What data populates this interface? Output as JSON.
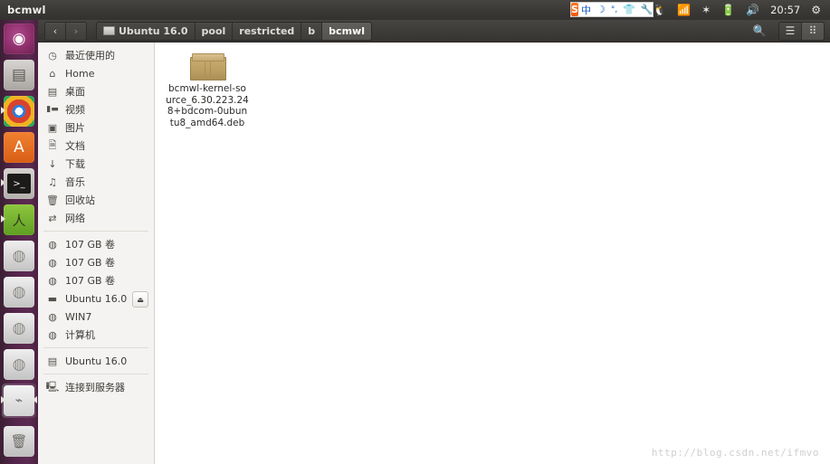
{
  "window": {
    "title": "bcmwl"
  },
  "top_panel": {
    "ime": {
      "logo": "S",
      "items": [
        {
          "name": "ime-mode-chinese",
          "glyph": "中"
        },
        {
          "name": "ime-moon-icon",
          "glyph": "☽"
        },
        {
          "name": "ime-punctuation-icon",
          "glyph": "°,"
        },
        {
          "name": "ime-skin-icon",
          "glyph": "👕"
        },
        {
          "name": "ime-toolbox-icon",
          "glyph": "🔧"
        }
      ]
    },
    "tray": [
      {
        "name": "linux-penguin-icon",
        "glyph": "🐧"
      },
      {
        "name": "wifi-icon",
        "glyph": "📶"
      },
      {
        "name": "bluetooth-icon",
        "glyph": "✶"
      },
      {
        "name": "battery-icon",
        "glyph": "🔋"
      },
      {
        "name": "volume-icon",
        "glyph": "🔊"
      }
    ],
    "clock": "20:57",
    "settings_icon": "⚙"
  },
  "launcher": {
    "items": [
      {
        "name": "launcher-ubuntu-dash",
        "label": "Ubuntu Dash",
        "style": "li-dash",
        "glyph": "◉",
        "active": false,
        "selected": false
      },
      {
        "name": "launcher-files",
        "label": "Files",
        "style": "li-files",
        "glyph": "▤",
        "active": false,
        "selected": false
      },
      {
        "name": "launcher-chrome",
        "label": "Google Chrome",
        "style": "li-chrome",
        "glyph": "",
        "active": true,
        "selected": false
      },
      {
        "name": "launcher-ubuntu-software",
        "label": "Ubuntu Software",
        "style": "li-soft",
        "glyph": "A",
        "active": false,
        "selected": false
      },
      {
        "name": "launcher-terminal",
        "label": "Terminal",
        "style": "li-term",
        "glyph": ">_",
        "active": true,
        "selected": false
      },
      {
        "name": "launcher-android-studio",
        "label": "Android Studio",
        "style": "li-as",
        "glyph": "A",
        "active": true,
        "selected": false
      },
      {
        "name": "launcher-drive-1",
        "label": "107 GB Volume",
        "style": "li-drive",
        "glyph": "◍",
        "active": false,
        "selected": false
      },
      {
        "name": "launcher-drive-2",
        "label": "107 GB Volume",
        "style": "li-drive",
        "glyph": "◍",
        "active": false,
        "selected": false
      },
      {
        "name": "launcher-drive-3",
        "label": "107 GB Volume",
        "style": "li-drive",
        "glyph": "◍",
        "active": false,
        "selected": false
      },
      {
        "name": "launcher-drive-4",
        "label": "WIN7",
        "style": "li-drive",
        "glyph": "◍",
        "active": false,
        "selected": false
      },
      {
        "name": "launcher-usb-drive",
        "label": "Ubuntu 16.0",
        "style": "li-usb",
        "glyph": "⌁",
        "active": true,
        "selected": true
      }
    ],
    "trash": {
      "name": "launcher-trash",
      "label": "Trash",
      "style": "li-trash",
      "glyph": "🗑"
    }
  },
  "toolbar": {
    "back_glyph": "‹",
    "forward_glyph": "›",
    "breadcrumbs": [
      {
        "label": "Ubuntu 16.0",
        "icon": "drive-icon",
        "active": false
      },
      {
        "label": "pool",
        "icon": "",
        "active": false
      },
      {
        "label": "restricted",
        "icon": "",
        "active": false
      },
      {
        "label": "b",
        "icon": "",
        "active": false
      },
      {
        "label": "bcmwl",
        "icon": "",
        "active": true
      }
    ],
    "search_icon": "🔍",
    "list_view_icon": "☰",
    "grid_view_icon": "⠿"
  },
  "sidebar": {
    "groups": [
      {
        "items": [
          {
            "label": "最近使用的",
            "icon": "clock-icon",
            "glyph": "◷",
            "eject": false
          },
          {
            "label": "Home",
            "icon": "home-icon",
            "glyph": "⌂",
            "eject": false
          },
          {
            "label": "桌面",
            "icon": "desktop-folder-icon",
            "glyph": "▤",
            "eject": false
          },
          {
            "label": "视频",
            "icon": "video-icon",
            "glyph": "▮▬",
            "eject": false
          },
          {
            "label": "图片",
            "icon": "camera-icon",
            "glyph": "▣",
            "eject": false
          },
          {
            "label": "文档",
            "icon": "document-icon",
            "glyph": "🗎",
            "eject": false
          },
          {
            "label": "下载",
            "icon": "download-icon",
            "glyph": "↓",
            "eject": false
          },
          {
            "label": "音乐",
            "icon": "music-icon",
            "glyph": "♫",
            "eject": false
          },
          {
            "label": "回收站",
            "icon": "trash-icon",
            "glyph": "🗑",
            "eject": false
          },
          {
            "label": "网络",
            "icon": "network-icon",
            "glyph": "⇄",
            "eject": false
          }
        ]
      },
      {
        "items": [
          {
            "label": "107 GB 卷",
            "icon": "hdd-icon",
            "glyph": "◍",
            "eject": false
          },
          {
            "label": "107 GB 卷",
            "icon": "hdd-icon",
            "glyph": "◍",
            "eject": false
          },
          {
            "label": "107 GB 卷",
            "icon": "hdd-icon",
            "glyph": "◍",
            "eject": false
          },
          {
            "label": "Ubuntu 16.0",
            "icon": "usb-drive-icon",
            "glyph": "▬",
            "eject": true
          },
          {
            "label": "WIN7",
            "icon": "hdd-icon",
            "glyph": "◍",
            "eject": false
          },
          {
            "label": "计算机",
            "icon": "computer-icon",
            "glyph": "◍",
            "eject": false
          }
        ]
      },
      {
        "items": [
          {
            "label": "Ubuntu 16.0",
            "icon": "folder-icon",
            "glyph": "▤",
            "eject": false
          }
        ]
      },
      {
        "items": [
          {
            "label": "连接到服务器",
            "icon": "connect-server-icon",
            "glyph": "🖳",
            "eject": false
          }
        ]
      }
    ],
    "eject_glyph": "⏏"
  },
  "content": {
    "files": [
      {
        "name": "bcmwl-kernel-source_6.30.223.248+bdcom-0ubuntu8_amd64.deb",
        "icon": "deb-package-icon"
      }
    ],
    "watermark": "http://blog.csdn.net/ifmvo"
  }
}
